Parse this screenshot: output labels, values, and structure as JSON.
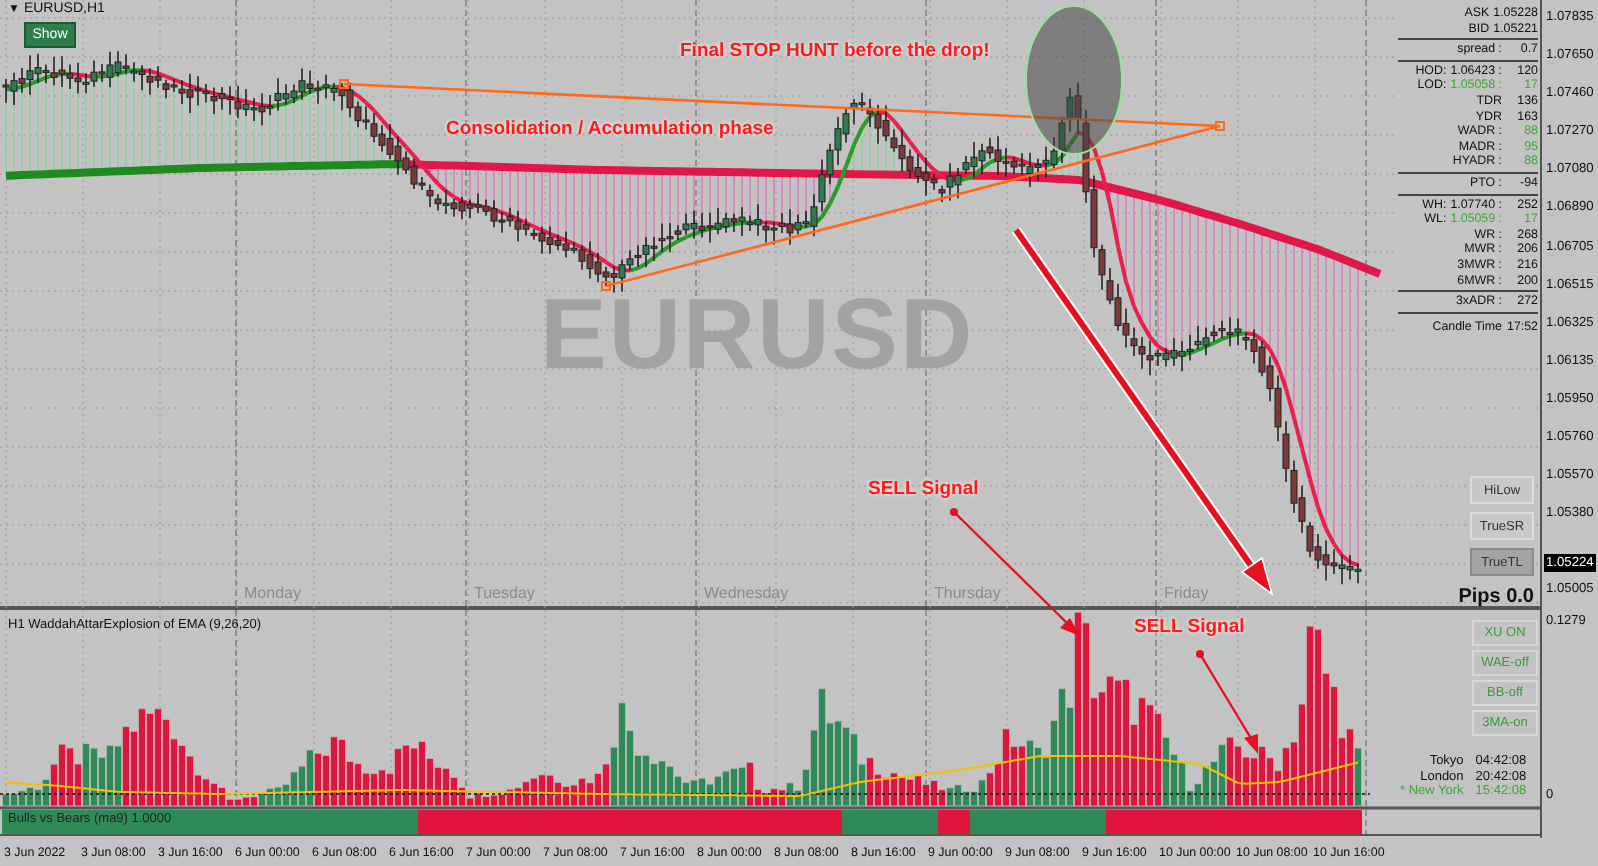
{
  "chart_header": {
    "menu_glyph": "▼",
    "symbol": "EURUSD,H1"
  },
  "show_button": "Show",
  "background_symbol": "EURUSD",
  "annotations": [
    {
      "text": "Final STOP HUNT before the drop!"
    },
    {
      "text": "Consolidation / Accumulation phase"
    },
    {
      "text": "SELL Signal"
    },
    {
      "text": "SELL Signal"
    }
  ],
  "info_panel": {
    "groups": [
      [
        {
          "label": "ASK",
          "value": "1.05228",
          "highlight": false
        },
        {
          "label": "BID",
          "value": "1.05221",
          "highlight": false
        }
      ],
      [
        {
          "label": "spread :",
          "value": "0.7",
          "highlight": false
        }
      ],
      [
        {
          "label": "HOD:",
          "price": "1.06423 :",
          "value": "120",
          "highlight": false
        },
        {
          "label": "LOD:",
          "price": "1.05058 :",
          "value": "17",
          "highlight": true
        },
        {
          "label": "TDR",
          "value": "136",
          "highlight": false
        },
        {
          "label": "YDR",
          "value": "163",
          "highlight": false
        },
        {
          "label": "WADR :",
          "value": "88",
          "highlight": true
        },
        {
          "label": "MADR :",
          "value": "95",
          "highlight": true
        },
        {
          "label": "HYADR :",
          "value": "88",
          "highlight": true
        }
      ],
      [
        {
          "label": "PTO :",
          "value": "-94",
          "highlight": false
        }
      ],
      [
        {
          "label": "WH:",
          "price": "1.07740 :",
          "value": "252",
          "highlight": false
        },
        {
          "label": "WL:",
          "price": "1.05059 :",
          "value": "17",
          "highlight": true
        },
        {
          "label": "WR :",
          "value": "268",
          "highlight": false
        },
        {
          "label": "MWR :",
          "value": "206",
          "highlight": false
        },
        {
          "label": "3MWR :",
          "value": "216",
          "highlight": false
        },
        {
          "label": "6MWR :",
          "value": "200",
          "highlight": false
        }
      ],
      [
        {
          "label": "3xADR :",
          "value": "272",
          "highlight": false
        }
      ]
    ],
    "candle_time": {
      "label": "Candle Time",
      "value": "17:52"
    }
  },
  "tool_buttons": [
    {
      "label": "HiLow",
      "selected": false
    },
    {
      "label": "TrueSR",
      "selected": false
    },
    {
      "label": "TrueTL",
      "selected": true
    }
  ],
  "pips_readout": "Pips 0.0",
  "day_labels": [
    "Monday",
    "Tuesday",
    "Wednesday",
    "Thursday",
    "Friday"
  ],
  "price_axis": {
    "ticks": [
      "1.07835",
      "1.07650",
      "1.07460",
      "1.07270",
      "1.07080",
      "1.06890",
      "1.06705",
      "1.06515",
      "1.06325",
      "1.06135",
      "1.05950",
      "1.05760",
      "1.05570",
      "1.05380",
      "1.05005"
    ],
    "current_price": "1.05224"
  },
  "indicator": {
    "title": "H1 WaddahAttarExplosion of EMA (9,26,20)",
    "axis_max": "0.1279",
    "axis_zero": "0",
    "strip_label": "Bulls vs Bears (ma9) 1.0000",
    "toggles": [
      {
        "label": "XU ON"
      },
      {
        "label": "WAE-off"
      },
      {
        "label": "BB-off"
      },
      {
        "label": "3MA-on"
      }
    ]
  },
  "clocks": [
    {
      "city": "Tokyo",
      "time": "04:42:08",
      "local": false
    },
    {
      "city": "London",
      "time": "20:42:08",
      "local": false
    },
    {
      "city": "* New York",
      "time": "15:42:08",
      "local": true
    }
  ],
  "time_axis": [
    "3 Jun 2022",
    "3 Jun 08:00",
    "3 Jun 16:00",
    "6 Jun 00:00",
    "6 Jun 08:00",
    "6 Jun 16:00",
    "7 Jun 00:00",
    "7 Jun 08:00",
    "7 Jun 16:00",
    "8 Jun 00:00",
    "8 Jun 08:00",
    "8 Jun 16:00",
    "9 Jun 00:00",
    "9 Jun 08:00",
    "9 Jun 16:00",
    "10 Jun 00:00",
    "10 Jun 08:00",
    "10 Jun 16:00"
  ]
}
